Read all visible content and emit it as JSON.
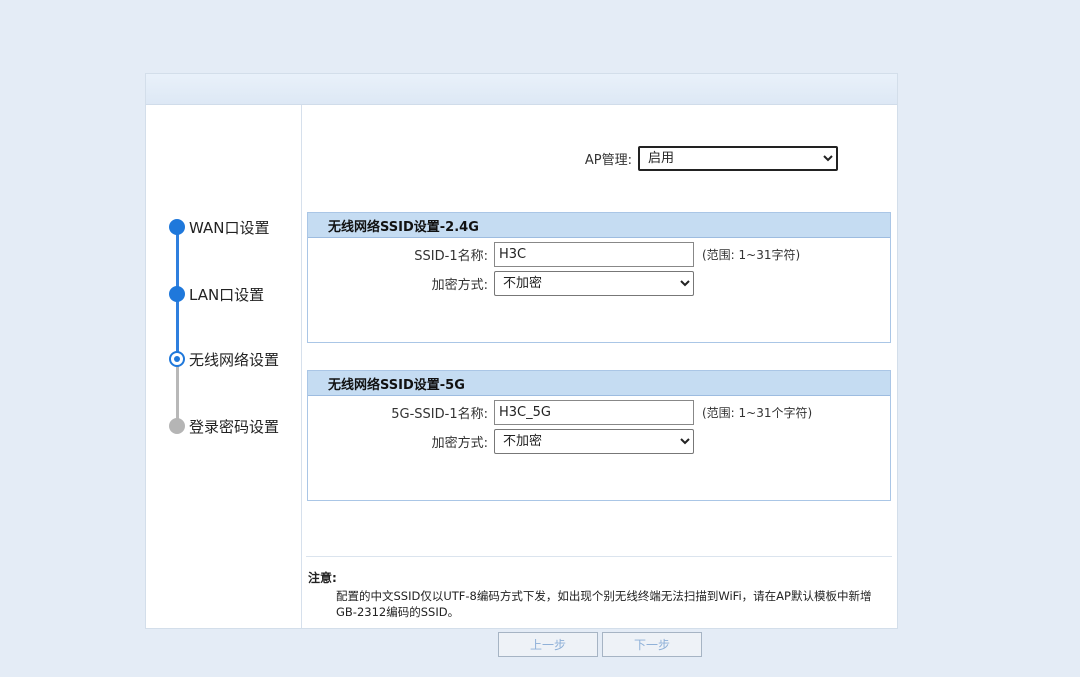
{
  "steps": [
    {
      "label": "WAN口设置",
      "state": "done"
    },
    {
      "label": "LAN口设置",
      "state": "done"
    },
    {
      "label": "无线网络设置",
      "state": "current"
    },
    {
      "label": "登录密码设置",
      "state": "todo"
    }
  ],
  "ap_management": {
    "label": "AP管理:",
    "value": "启用",
    "options": [
      "启用"
    ]
  },
  "section_24g": {
    "title": "无线网络SSID设置-2.4G",
    "ssid_label": "SSID-1名称:",
    "ssid_value": "H3C",
    "ssid_hint": "(范围: 1~31字符)",
    "encryption_label": "加密方式:",
    "encryption_value": "不加密",
    "encryption_options": [
      "不加密"
    ]
  },
  "section_5g": {
    "title": "无线网络SSID设置-5G",
    "ssid_label": "5G-SSID-1名称:",
    "ssid_value": "H3C_5G",
    "ssid_hint": "(范围: 1~31个字符)",
    "encryption_label": "加密方式:",
    "encryption_value": "不加密",
    "encryption_options": [
      "不加密"
    ]
  },
  "note": {
    "title": "注意:",
    "text": "配置的中文SSID仅以UTF-8编码方式下发，如出现个别无线终端无法扫描到WiFi，请在AP默认模板中新增GB-2312编码的SSID。"
  },
  "buttons": {
    "prev": "上一步",
    "next": "下一步"
  }
}
